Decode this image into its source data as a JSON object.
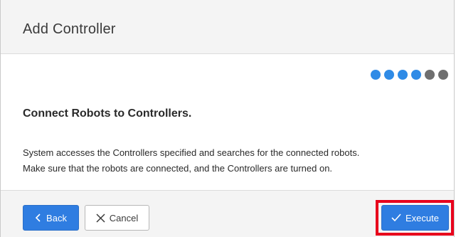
{
  "dialog": {
    "title": "Add Controller",
    "steps": [
      {
        "state": "completed"
      },
      {
        "state": "completed"
      },
      {
        "state": "completed"
      },
      {
        "state": "completed"
      },
      {
        "state": "pending"
      },
      {
        "state": "pending"
      }
    ],
    "heading": "Connect Robots to Controllers.",
    "description_line1": "System accesses the Controllers specified and searches for the connected robots.",
    "description_line2": "Make sure that the robots are connected, and the Controllers are turned on."
  },
  "footer": {
    "back_label": "Back",
    "cancel_label": "Cancel",
    "execute_label": "Execute",
    "back_icon": "chevron-left-icon",
    "cancel_icon": "close-icon",
    "execute_icon": "check-icon"
  },
  "colors": {
    "primary": "#2f7de1",
    "step_active": "#2f8be6",
    "step_inactive": "#6f6f6f",
    "highlight": "#e8001c"
  }
}
